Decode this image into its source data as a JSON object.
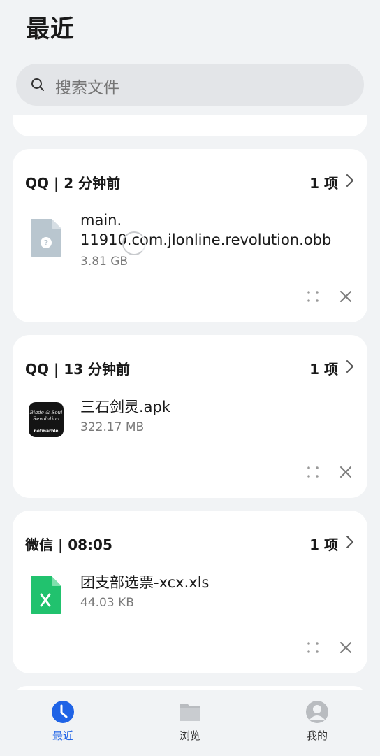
{
  "header": {
    "title": "最近"
  },
  "search": {
    "placeholder": "搜索文件"
  },
  "groups": [
    {
      "title": "QQ | 2 分钟前",
      "count": "1 项",
      "file": {
        "name": "main.\n11910.com.jlonline.revolution.obb",
        "size": "3.81 GB",
        "icon": "unknown-file-icon"
      }
    },
    {
      "title": "QQ | 13 分钟前",
      "count": "1 项",
      "file": {
        "name": "三石剑灵.apk",
        "size": "322.17 MB",
        "icon": "app-apk-icon"
      }
    },
    {
      "title": "微信 | 08:05",
      "count": "1 项",
      "file": {
        "name": "团支部选票-xcx.xls",
        "size": "44.03 KB",
        "icon": "excel-file-icon"
      }
    }
  ],
  "apk_icon_text": {
    "line1": "Blade & Soul",
    "line2": "Revolution",
    "brand": "netmarble"
  },
  "nav": {
    "items": [
      {
        "label": "最近",
        "icon": "clock-icon",
        "active": true
      },
      {
        "label": "浏览",
        "icon": "folder-icon",
        "active": false
      },
      {
        "label": "我的",
        "icon": "profile-icon",
        "active": false
      }
    ]
  },
  "colors": {
    "accent": "#1f63e6",
    "excel": "#21c26e",
    "unknown_file": "#b9c6cf"
  }
}
